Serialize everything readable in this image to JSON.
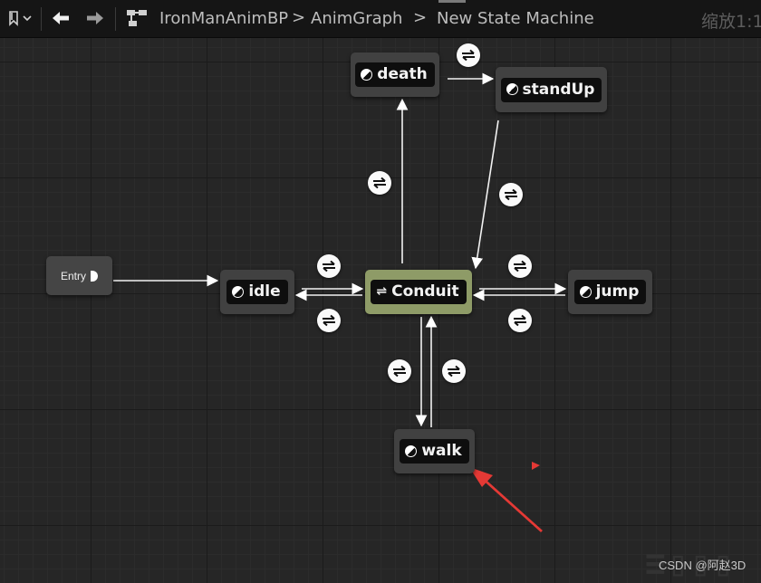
{
  "toolbar": {
    "bookmark_icon": "bookmark-icon",
    "back_icon": "arrow-left-icon",
    "forward_icon": "arrow-right-icon",
    "hierarchy_icon": "hierarchy-icon",
    "breadcrumbs": [
      "IronManAnimBP",
      "AnimGraph",
      "New State Machine"
    ],
    "zoom_label": "缩放1:1"
  },
  "graph": {
    "entry_label": "Entry",
    "states": {
      "death": "death",
      "standup": "standUp",
      "idle": "idle",
      "conduit": "Conduit",
      "jump": "jump",
      "walk": "walk"
    },
    "transition_icon": "transition-rule-icon"
  },
  "colors": {
    "graph_background": "#262626",
    "node_background": "#414141",
    "conduit_background": "#8e9b67",
    "annotation_arrow": "#e53935"
  },
  "watermark": "CSDN @阿赵3D"
}
